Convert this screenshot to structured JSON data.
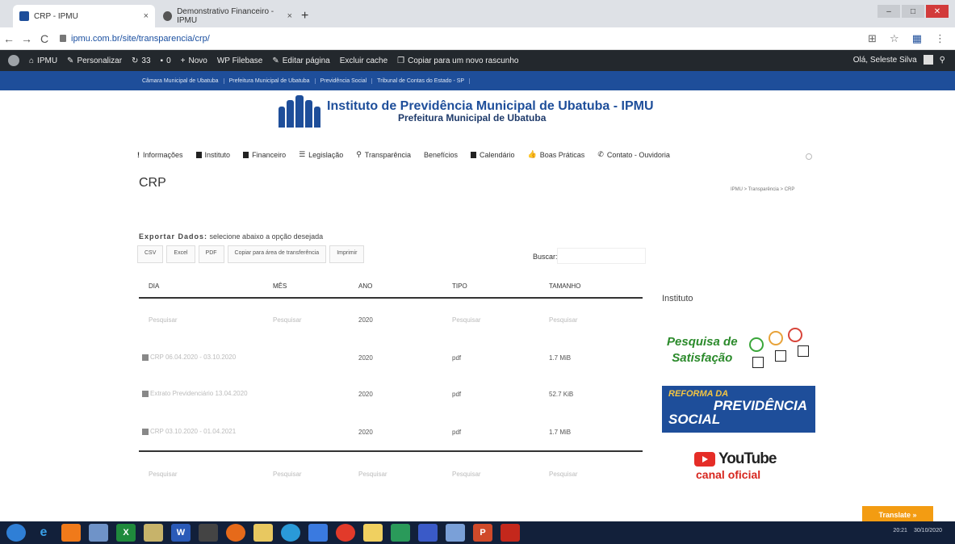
{
  "browser": {
    "tabs": [
      {
        "title": "CRP - IPMU",
        "close": "×"
      },
      {
        "title": "Demonstrativo Financeiro - IPMU",
        "close": "×"
      }
    ],
    "new_tab": "+",
    "url": "ipmu.com.br/site/transparencia/crp/"
  },
  "adminbar": {
    "items": [
      "IPMU",
      "Personalizar",
      "33",
      "0",
      "Novo",
      "WP Filebase",
      "Editar página",
      "Excluir cache",
      "Copiar para um novo rascunho"
    ],
    "greeting": "Olá, Seleste Silva"
  },
  "linkbar": [
    "Câmara Municipal de Ubatuba",
    "Prefeitura Municipal de Ubatuba",
    "Previdência Social",
    "Tribunal de Contas do Estado - SP"
  ],
  "site": {
    "title": "Instituto de Previdência Municipal de Ubatuba - IPMU",
    "subtitle": "Prefeitura Municipal de Ubatuba"
  },
  "menu": [
    "Informações",
    "Instituto",
    "Financeiro",
    "Legislação",
    "Transparência",
    "Benefícios",
    "Calendário",
    "Boas Práticas",
    "Contato - Ouvidoria"
  ],
  "page": {
    "title": "CRP",
    "breadcrumb": "IPMU > Transparência > CRP"
  },
  "export": {
    "label": "Exportar Dados:",
    "hint": "selecione abaixo a opção desejada",
    "buttons": [
      "CSV",
      "Excel",
      "PDF",
      "Copiar para área de transferência",
      "Imprimir"
    ],
    "search_label": "Buscar:"
  },
  "table": {
    "headers": [
      "DIA",
      "MÊS",
      "ANO",
      "TIPO",
      "TAMANHO"
    ],
    "filters": [
      "Pesquisar",
      "Pesquisar",
      "2020",
      "Pesquisar",
      "Pesquisar"
    ],
    "rows": [
      {
        "dia": "CRP 06.04.2020 - 03.10.2020",
        "ano": "2020",
        "tipo": "pdf",
        "tamanho": "1.7 MiB"
      },
      {
        "dia": "Extrato Previdenciário 13.04.2020",
        "ano": "2020",
        "tipo": "pdf",
        "tamanho": "52.7 KiB"
      },
      {
        "dia": "CRP 03.10.2020 - 01.04.2021",
        "ano": "2020",
        "tipo": "pdf",
        "tamanho": "1.7 MiB"
      }
    ],
    "footer_filters": [
      "Pesquisar",
      "Pesquisar",
      "Pesquisar",
      "Pesquisar",
      "Pesquisar"
    ]
  },
  "sidebar": {
    "title": "Instituto",
    "pesquisa": [
      "Pesquisa de",
      "Satisfação"
    ],
    "reforma": [
      "REFORMA DA",
      "PREVIDÊNCIA",
      "SOCIAL"
    ],
    "youtube": "YouTube",
    "youtube_sub": "canal oficial"
  },
  "translate": "Translate »",
  "taskbar": {
    "time": "20:21",
    "date": "30/10/2020"
  }
}
